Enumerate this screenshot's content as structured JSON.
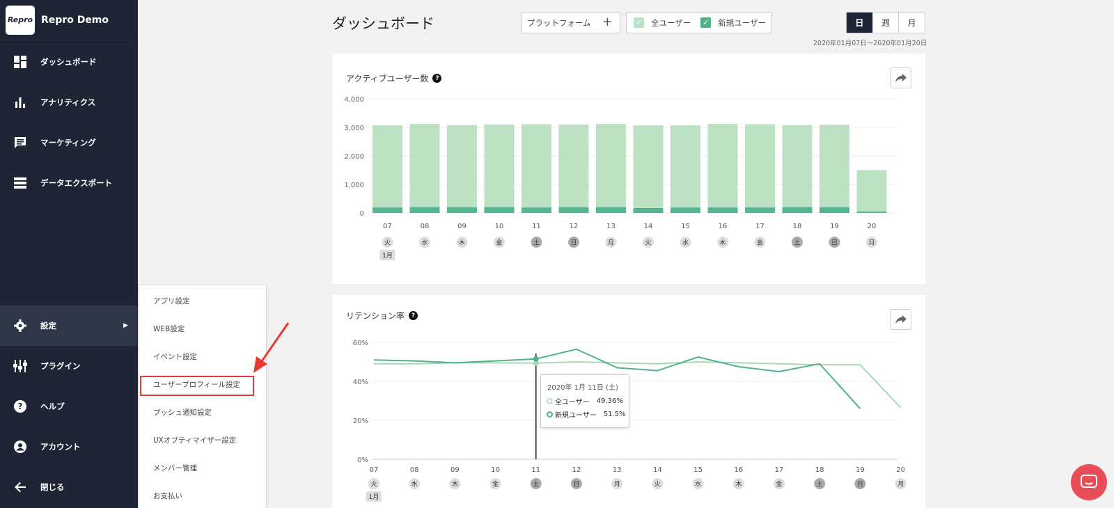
{
  "app": {
    "name": "Repro Demo",
    "logo_text": "Repro"
  },
  "sidebar": {
    "items": [
      {
        "label": "ダッシュボード",
        "icon": "dashboard-icon"
      },
      {
        "label": "アナリティクス",
        "icon": "bar-chart-icon"
      },
      {
        "label": "マーケティング",
        "icon": "chat-icon"
      },
      {
        "label": "データエクスポート",
        "icon": "list-icon"
      },
      {
        "label": "設定",
        "icon": "gear-icon"
      },
      {
        "label": "プラグイン",
        "icon": "plugin-icon"
      },
      {
        "label": "ヘルプ",
        "icon": "help-icon"
      },
      {
        "label": "アカウント",
        "icon": "account-icon"
      },
      {
        "label": "閉じる",
        "icon": "arrow-left-icon"
      }
    ]
  },
  "submenu": {
    "items": [
      {
        "label": "アプリ設定"
      },
      {
        "label": "WEB設定"
      },
      {
        "label": "イベント設定"
      },
      {
        "label": "ユーザープロフィール設定"
      },
      {
        "label": "プッシュ通知設定"
      },
      {
        "label": "UXオプティマイザー設定"
      },
      {
        "label": "メンバー管理"
      },
      {
        "label": "お支払い"
      }
    ],
    "highlighted_index": 3
  },
  "header": {
    "title": "ダッシュボード",
    "platform_label": "プラットフォーム",
    "filters": [
      {
        "label": "全ユーザー",
        "checked": true,
        "color": "#b8e0c2"
      },
      {
        "label": "新規ユーザー",
        "checked": true,
        "color": "#4fb38a"
      }
    ],
    "period": [
      "日",
      "週",
      "月"
    ],
    "period_active": 0,
    "date_range": "2020年01月07日〜2020年01月20日"
  },
  "colors": {
    "all_users": "#bce1c3",
    "new_users": "#52b690",
    "sidebar": "#1f2535",
    "chat": "#e94e58"
  },
  "active_users": {
    "title": "アクティブユーザー数",
    "chart_data": {
      "type": "bar",
      "categories": [
        "07",
        "08",
        "09",
        "10",
        "11",
        "12",
        "13",
        "14",
        "15",
        "16",
        "17",
        "18",
        "19",
        "20"
      ],
      "weekdays": [
        "火",
        "水",
        "木",
        "金",
        "土",
        "日",
        "月",
        "火",
        "水",
        "木",
        "金",
        "土",
        "日",
        "月"
      ],
      "month_label": "1月",
      "series": [
        {
          "name": "全ユーザー",
          "values": [
            3070,
            3120,
            3080,
            3100,
            3110,
            3100,
            3120,
            3070,
            3070,
            3120,
            3110,
            3080,
            3090,
            1500
          ]
        },
        {
          "name": "新規ユーザー",
          "values": [
            190,
            200,
            200,
            200,
            190,
            200,
            200,
            170,
            190,
            190,
            190,
            200,
            200,
            50
          ]
        }
      ],
      "ylim": [
        0,
        4000
      ],
      "yticks": [
        "0",
        "1,000",
        "2,000",
        "3,000",
        "4,000"
      ],
      "yticks_values": [
        0,
        1000,
        2000,
        3000,
        4000
      ]
    }
  },
  "retention": {
    "title": "リテンション率",
    "chart_data": {
      "type": "line",
      "categories": [
        "07",
        "08",
        "09",
        "10",
        "11",
        "12",
        "13",
        "14",
        "15",
        "16",
        "17",
        "18",
        "19",
        "20"
      ],
      "weekdays": [
        "火",
        "水",
        "木",
        "金",
        "土",
        "日",
        "月",
        "火",
        "水",
        "木",
        "金",
        "土",
        "日",
        "月"
      ],
      "month_label": "1月",
      "series": [
        {
          "name": "全ユーザー",
          "values": [
            49,
            49,
            49.5,
            49.5,
            49.36,
            50,
            49.5,
            49,
            50,
            49.5,
            49,
            48.5,
            48.5,
            26.5
          ]
        },
        {
          "name": "新規ユーザー",
          "values": [
            51,
            50.5,
            49.5,
            50.5,
            51.5,
            56.5,
            47,
            45.5,
            52.5,
            47.5,
            45,
            49,
            26
          ]
        }
      ],
      "ylim": [
        0,
        60
      ],
      "yticks": [
        "0%",
        "20%",
        "40%",
        "60%"
      ],
      "yticks_values": [
        0,
        20,
        40,
        60
      ]
    },
    "tooltip": {
      "date": "2020年 1月 11日 (土)",
      "rows": [
        {
          "label": "全ユーザー",
          "value": "49.36%"
        },
        {
          "label": "新規ユーザー",
          "value": "51.5%"
        }
      ]
    }
  }
}
